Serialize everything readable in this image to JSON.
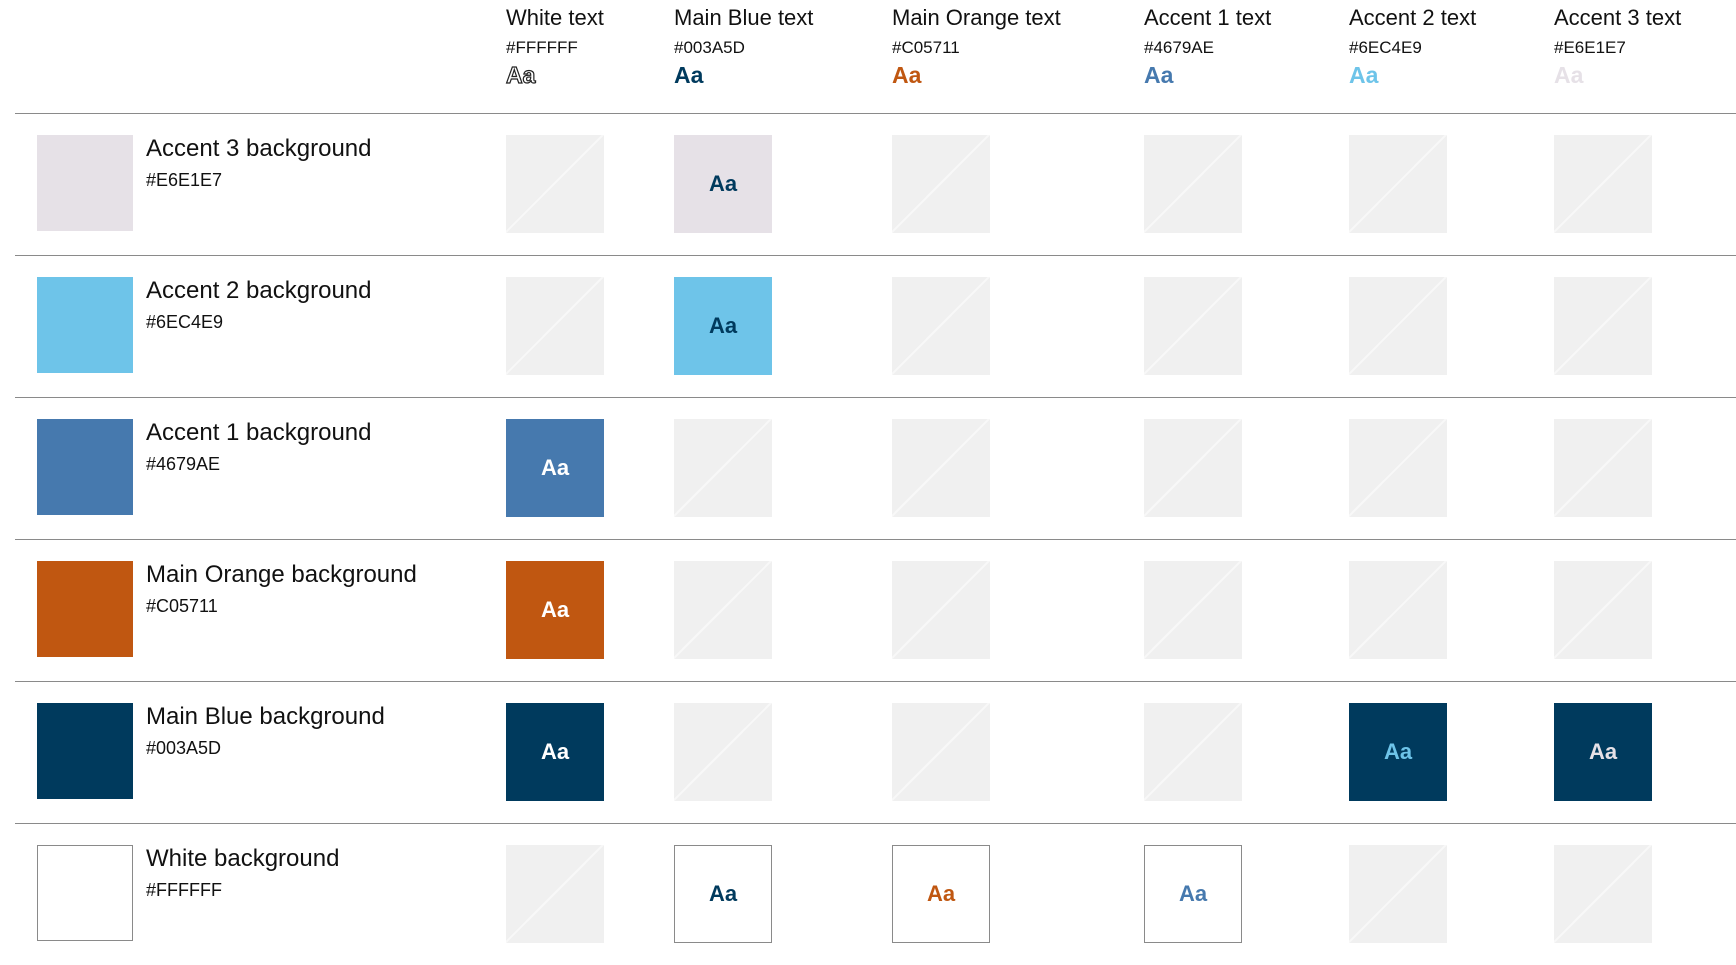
{
  "columns": [
    {
      "label": "White text",
      "hex": "#FFFFFF",
      "sample": "Aa",
      "color": "#FFFFFF",
      "outlined": true
    },
    {
      "label": "Main Blue text",
      "hex": "#003A5D",
      "sample": "Aa",
      "color": "#003A5D",
      "outlined": false
    },
    {
      "label": "Main Orange text",
      "hex": "#C05711",
      "sample": "Aa",
      "color": "#C05711",
      "outlined": false
    },
    {
      "label": "Accent 1 text",
      "hex": "#4679AE",
      "sample": "Aa",
      "color": "#4679AE",
      "outlined": false
    },
    {
      "label": "Accent 2 text",
      "hex": "#6EC4E9",
      "sample": "Aa",
      "color": "#6EC4E9",
      "outlined": false
    },
    {
      "label": "Accent 3 text",
      "hex": "#E6E1E7",
      "sample": "Aa",
      "color": "#E6E1E7",
      "outlined": false
    }
  ],
  "rows": [
    {
      "label": "Accent 3 background",
      "hex": "#E6E1E7",
      "color": "#E6E1E7",
      "outlined": false,
      "cells": [
        {
          "sample": ""
        },
        {
          "sample": "Aa",
          "text_color": "#003A5D"
        },
        {
          "sample": ""
        },
        {
          "sample": ""
        },
        {
          "sample": ""
        },
        {
          "sample": ""
        }
      ]
    },
    {
      "label": "Accent 2 background",
      "hex": "#6EC4E9",
      "color": "#6EC4E9",
      "outlined": false,
      "cells": [
        {
          "sample": ""
        },
        {
          "sample": "Aa",
          "text_color": "#003A5D"
        },
        {
          "sample": ""
        },
        {
          "sample": ""
        },
        {
          "sample": ""
        },
        {
          "sample": ""
        }
      ]
    },
    {
      "label": "Accent 1 background",
      "hex": "#4679AE",
      "color": "#4679AE",
      "outlined": false,
      "cells": [
        {
          "sample": "Aa",
          "text_color": "#FFFFFF"
        },
        {
          "sample": ""
        },
        {
          "sample": ""
        },
        {
          "sample": ""
        },
        {
          "sample": ""
        },
        {
          "sample": ""
        }
      ]
    },
    {
      "label": "Main Orange background",
      "hex": "#C05711",
      "color": "#C05711",
      "outlined": false,
      "cells": [
        {
          "sample": "Aa",
          "text_color": "#FFFFFF"
        },
        {
          "sample": ""
        },
        {
          "sample": ""
        },
        {
          "sample": ""
        },
        {
          "sample": ""
        },
        {
          "sample": ""
        }
      ]
    },
    {
      "label": "Main Blue background",
      "hex": "#003A5D",
      "color": "#003A5D",
      "outlined": false,
      "cells": [
        {
          "sample": "Aa",
          "text_color": "#FFFFFF"
        },
        {
          "sample": ""
        },
        {
          "sample": ""
        },
        {
          "sample": ""
        },
        {
          "sample": "Aa",
          "text_color": "#6EC4E9"
        },
        {
          "sample": "Aa",
          "text_color": "#E6E1E7"
        }
      ]
    },
    {
      "label": "White background",
      "hex": "#FFFFFF",
      "color": "#FFFFFF",
      "outlined": true,
      "cells": [
        {
          "sample": ""
        },
        {
          "sample": "Aa",
          "text_color": "#003A5D"
        },
        {
          "sample": "Aa",
          "text_color": "#C05711"
        },
        {
          "sample": "Aa",
          "text_color": "#4679AE"
        },
        {
          "sample": ""
        },
        {
          "sample": ""
        }
      ]
    }
  ]
}
